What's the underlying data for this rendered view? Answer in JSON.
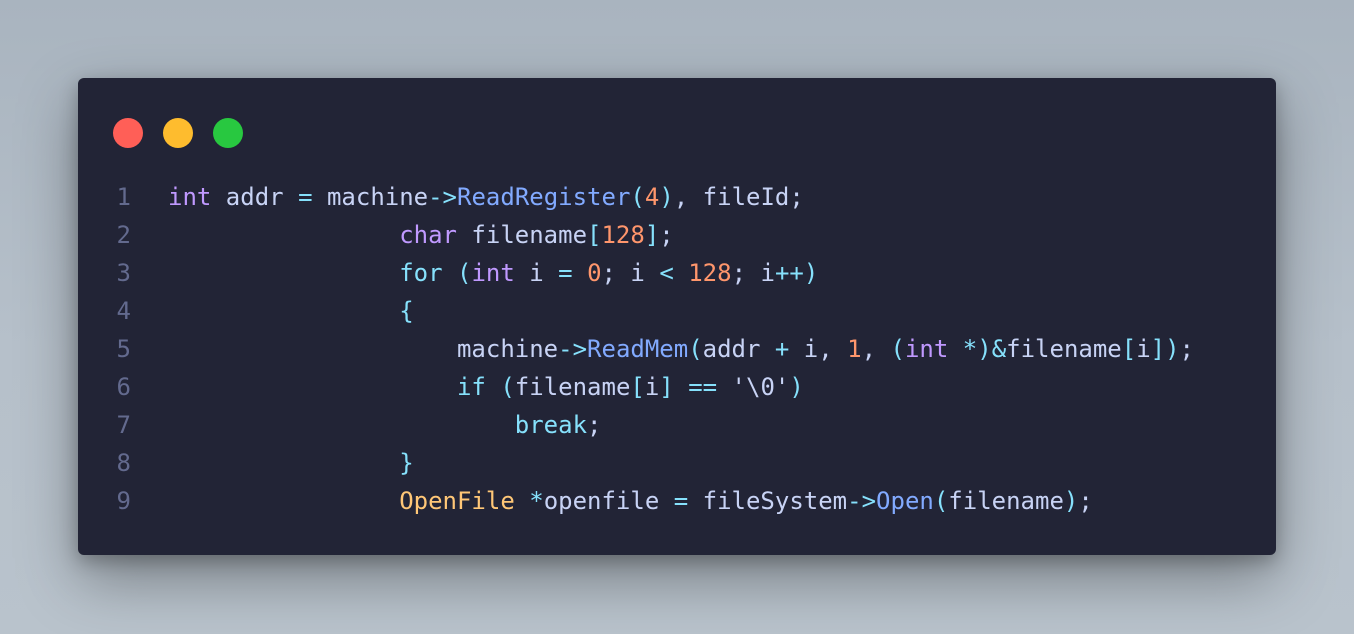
{
  "colors": {
    "background": "#222436",
    "close": "#ff5f57",
    "minimize": "#febc2e",
    "maximize": "#28c840",
    "default": "#c8d3f5",
    "keyword": "#c099ff",
    "function": "#82aaff",
    "number": "#ff966c",
    "operator": "#86e1fc",
    "type": "#ffc777",
    "line_number": "#636a8e"
  },
  "window_controls": [
    "close-button",
    "minimize-button",
    "maximize-button"
  ],
  "code_lines": [
    {
      "number": "1",
      "tokens": [
        {
          "t": "int",
          "c": "keyword"
        },
        {
          "t": " addr ",
          "c": "default"
        },
        {
          "t": "=",
          "c": "operator"
        },
        {
          "t": " machine",
          "c": "default"
        },
        {
          "t": "->",
          "c": "operator"
        },
        {
          "t": "ReadRegister",
          "c": "function"
        },
        {
          "t": "(",
          "c": "operator"
        },
        {
          "t": "4",
          "c": "number"
        },
        {
          "t": ")",
          "c": "operator"
        },
        {
          "t": ", fileId;",
          "c": "default"
        }
      ]
    },
    {
      "number": "2",
      "tokens": [
        {
          "t": "                ",
          "c": "default"
        },
        {
          "t": "char",
          "c": "keyword"
        },
        {
          "t": " filename",
          "c": "default"
        },
        {
          "t": "[",
          "c": "operator"
        },
        {
          "t": "128",
          "c": "number"
        },
        {
          "t": "]",
          "c": "operator"
        },
        {
          "t": ";",
          "c": "default"
        }
      ]
    },
    {
      "number": "3",
      "tokens": [
        {
          "t": "                ",
          "c": "default"
        },
        {
          "t": "for",
          "c": "operator"
        },
        {
          "t": " (",
          "c": "operator"
        },
        {
          "t": "int",
          "c": "keyword"
        },
        {
          "t": " i ",
          "c": "default"
        },
        {
          "t": "=",
          "c": "operator"
        },
        {
          "t": " ",
          "c": "default"
        },
        {
          "t": "0",
          "c": "number"
        },
        {
          "t": "; i ",
          "c": "default"
        },
        {
          "t": "<",
          "c": "operator"
        },
        {
          "t": " ",
          "c": "default"
        },
        {
          "t": "128",
          "c": "number"
        },
        {
          "t": "; i",
          "c": "default"
        },
        {
          "t": "++",
          "c": "operator"
        },
        {
          "t": ")",
          "c": "operator"
        }
      ]
    },
    {
      "number": "4",
      "tokens": [
        {
          "t": "                ",
          "c": "default"
        },
        {
          "t": "{",
          "c": "operator"
        }
      ]
    },
    {
      "number": "5",
      "tokens": [
        {
          "t": "                    machine",
          "c": "default"
        },
        {
          "t": "->",
          "c": "operator"
        },
        {
          "t": "ReadMem",
          "c": "function"
        },
        {
          "t": "(",
          "c": "operator"
        },
        {
          "t": "addr ",
          "c": "default"
        },
        {
          "t": "+",
          "c": "operator"
        },
        {
          "t": " i, ",
          "c": "default"
        },
        {
          "t": "1",
          "c": "number"
        },
        {
          "t": ", ",
          "c": "default"
        },
        {
          "t": "(",
          "c": "operator"
        },
        {
          "t": "int",
          "c": "keyword"
        },
        {
          "t": " ",
          "c": "default"
        },
        {
          "t": "*",
          "c": "operator"
        },
        {
          "t": ")",
          "c": "operator"
        },
        {
          "t": "&",
          "c": "operator"
        },
        {
          "t": "filename",
          "c": "default"
        },
        {
          "t": "[",
          "c": "operator"
        },
        {
          "t": "i",
          "c": "default"
        },
        {
          "t": "])",
          "c": "operator"
        },
        {
          "t": ";",
          "c": "default"
        }
      ]
    },
    {
      "number": "6",
      "tokens": [
        {
          "t": "                    ",
          "c": "default"
        },
        {
          "t": "if",
          "c": "operator"
        },
        {
          "t": " (",
          "c": "operator"
        },
        {
          "t": "filename",
          "c": "default"
        },
        {
          "t": "[",
          "c": "operator"
        },
        {
          "t": "i",
          "c": "default"
        },
        {
          "t": "]",
          "c": "operator"
        },
        {
          "t": " ",
          "c": "default"
        },
        {
          "t": "==",
          "c": "operator"
        },
        {
          "t": " '\\0'",
          "c": "default"
        },
        {
          "t": ")",
          "c": "operator"
        }
      ]
    },
    {
      "number": "7",
      "tokens": [
        {
          "t": "                        ",
          "c": "default"
        },
        {
          "t": "break",
          "c": "operator"
        },
        {
          "t": ";",
          "c": "default"
        }
      ]
    },
    {
      "number": "8",
      "tokens": [
        {
          "t": "                ",
          "c": "default"
        },
        {
          "t": "}",
          "c": "operator"
        }
      ]
    },
    {
      "number": "9",
      "tokens": [
        {
          "t": "                ",
          "c": "default"
        },
        {
          "t": "OpenFile",
          "c": "type"
        },
        {
          "t": " ",
          "c": "default"
        },
        {
          "t": "*",
          "c": "operator"
        },
        {
          "t": "openfile ",
          "c": "default"
        },
        {
          "t": "=",
          "c": "operator"
        },
        {
          "t": " fileSystem",
          "c": "default"
        },
        {
          "t": "->",
          "c": "operator"
        },
        {
          "t": "Open",
          "c": "function"
        },
        {
          "t": "(",
          "c": "operator"
        },
        {
          "t": "filename",
          "c": "default"
        },
        {
          "t": ")",
          "c": "operator"
        },
        {
          "t": ";",
          "c": "default"
        }
      ]
    }
  ]
}
